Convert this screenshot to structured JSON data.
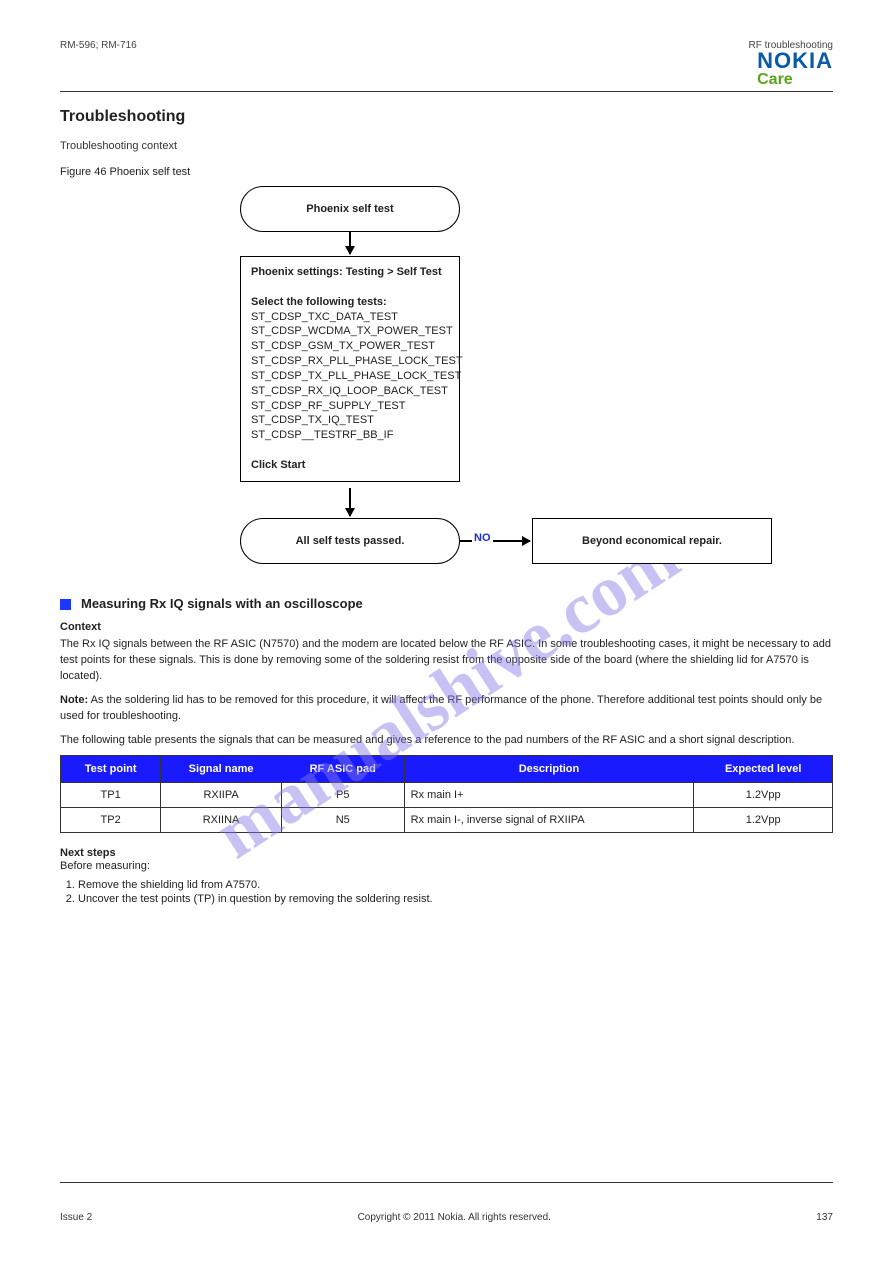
{
  "header": {
    "left": "RM-596; RM-716",
    "right": "RF troubleshooting",
    "brand": "NOKIA",
    "subbrand": "Care"
  },
  "diagram": {
    "watermark": "manualshive.com",
    "section_title": "Troubleshooting",
    "context_label": "Troubleshooting context",
    "figure_caption": "Figure 46 Phoenix self test",
    "start": "Phoenix self test",
    "process_heading": "Phoenix settings:",
    "process_heading_bold": "Testing > Self Test",
    "select_label": "Select the following tests:",
    "tests": [
      "ST_CDSP_TXC_DATA_TEST",
      "ST_CDSP_WCDMA_TX_POWER_TEST",
      "ST_CDSP_GSM_TX_POWER_TEST",
      "ST_CDSP_RX_PLL_PHASE_LOCK_TEST",
      "ST_CDSP_TX_PLL_PHASE_LOCK_TEST",
      "ST_CDSP_RX_IQ_LOOP_BACK_TEST",
      "ST_CDSP_RF_SUPPLY_TEST",
      "ST_CDSP_TX_IQ_TEST",
      "ST_CDSP__TESTRF_BB_IF"
    ],
    "click_start": "Click Start",
    "decision": "All self tests passed.",
    "no_label": "NO",
    "terminal": "Beyond economical repair."
  },
  "measure": {
    "bullet_title": "Measuring Rx IQ signals with an oscilloscope",
    "context_label": "Context",
    "context_body": "The Rx IQ signals between the RF ASIC (N7570) and the modem are located below the RF ASIC. In some troubleshooting cases, it might be necessary to add test points for these signals. This is done by removing some of the soldering resist from the opposite side of the board (where the shielding lid for A7570 is located).",
    "note_label": "Note:",
    "note_body": "As the soldering lid has to be removed for this procedure, it will affect the RF performance of the phone. Therefore additional test points should only be used for troubleshooting.",
    "table_caption": "The following table presents the signals that can be measured and gives a reference to the pad numbers of the RF ASIC and a short signal description.",
    "table": {
      "headers": [
        "Test point",
        "Signal name",
        "RF ASIC pad",
        "Description",
        "Expected level"
      ],
      "rows": [
        [
          "TP1",
          "RXIIPA",
          "P5",
          "Rx main I+",
          "1.2Vpp"
        ],
        [
          "TP2",
          "RXIINA",
          "N5",
          "Rx main I-, inverse signal of RXIIPA",
          "1.2Vpp"
        ]
      ]
    }
  },
  "nextsteps": {
    "label": "Next steps",
    "before": "Before measuring:",
    "items": [
      "Remove the shielding lid from A7570.",
      "Uncover the test points (TP) in question by removing the soldering resist."
    ]
  },
  "footer": {
    "left": "Issue 2",
    "center": "Copyright © 2011 Nokia. All rights reserved.",
    "right": "137"
  }
}
